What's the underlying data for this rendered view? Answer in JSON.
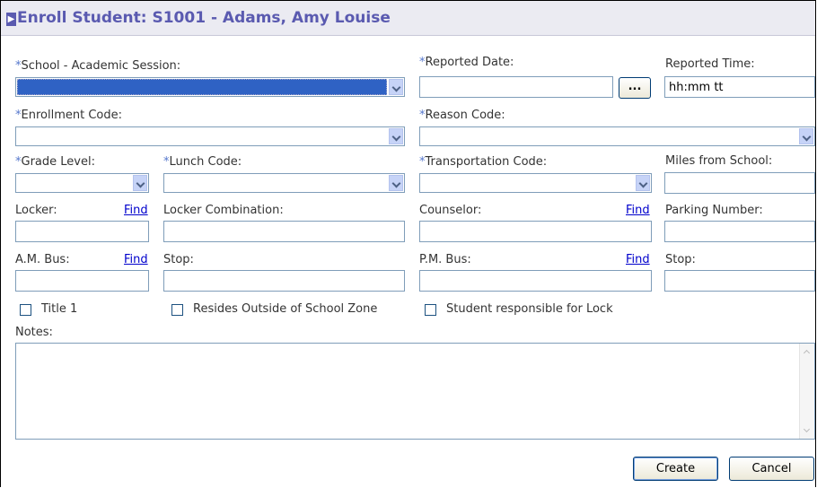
{
  "dialog": {
    "title": "Enroll Student: S1001 - Adams, Amy Louise"
  },
  "fields": {
    "school_session": {
      "req": "*",
      "label": "School - Academic Session:"
    },
    "reported_date": {
      "req": "*",
      "label": "Reported Date:",
      "value": "",
      "picker_label": "..."
    },
    "reported_time": {
      "label": "Reported Time:",
      "value": "hh:mm tt"
    },
    "enrollment_code": {
      "req": "*",
      "label": "Enrollment Code:"
    },
    "reason_code": {
      "req": "*",
      "label": "Reason Code:"
    },
    "grade_level": {
      "req": "*",
      "label": "Grade Level:"
    },
    "lunch_code": {
      "req": "*",
      "label": "Lunch Code:"
    },
    "transportation_code": {
      "req": "*",
      "label": "Transportation Code:"
    },
    "miles_from_school": {
      "label": "Miles from School:"
    },
    "locker": {
      "label": "Locker:",
      "find": "Find"
    },
    "locker_combination": {
      "label": "Locker Combination:"
    },
    "counselor": {
      "label": "Counselor:",
      "find": "Find"
    },
    "parking_number": {
      "label": "Parking Number:"
    },
    "am_bus": {
      "label": "A.M. Bus:",
      "find": "Find"
    },
    "am_stop": {
      "label": "Stop:"
    },
    "pm_bus": {
      "label": "P.M. Bus:",
      "find": "Find"
    },
    "pm_stop": {
      "label": "Stop:"
    },
    "notes": {
      "label": "Notes:"
    }
  },
  "checkboxes": {
    "title1": {
      "label": "Title 1",
      "checked": false
    },
    "resides_outside": {
      "label": "Resides Outside of School Zone",
      "checked": false
    },
    "responsible_lock": {
      "label": "Student responsible for Lock",
      "checked": false
    }
  },
  "buttons": {
    "create": "Create",
    "cancel": "Cancel"
  },
  "colors": {
    "title": "#5a5ab0",
    "required_marker": "#5577cc",
    "selection": "#2f62c4",
    "link": "#0000cc"
  }
}
